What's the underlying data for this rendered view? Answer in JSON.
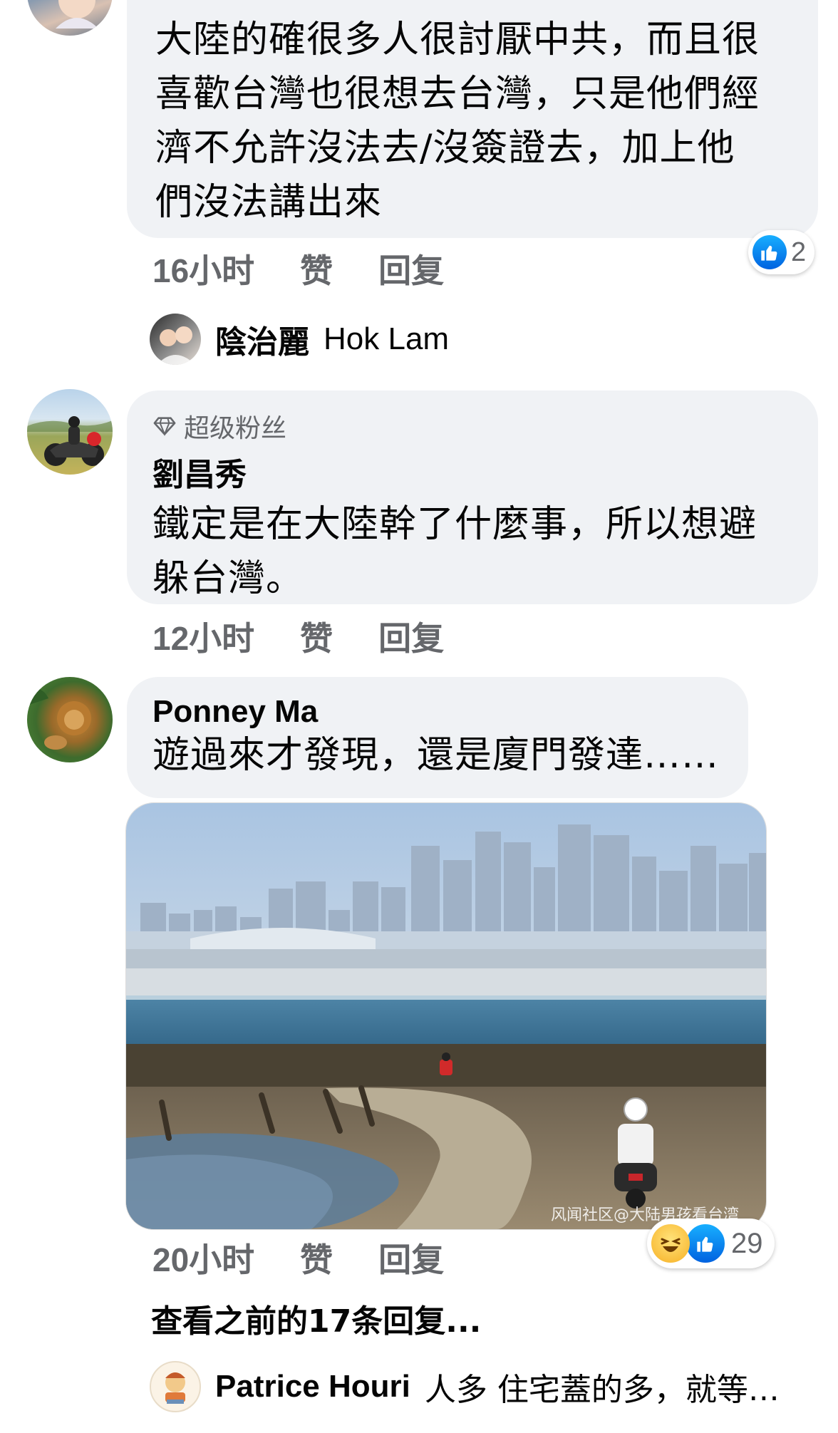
{
  "comments": [
    {
      "id": "c1",
      "text_lines": [
        "大陸的確很多人很討厭中共，而且很",
        "喜歡台灣也很想去台灣，只是他們經",
        "濟不允許沒法去/沒簽證去，加上他",
        "們沒法講出來"
      ],
      "time": "16小时",
      "like_label": "赞",
      "reply_label": "回复",
      "reaction_count": "2"
    },
    {
      "id": "c2",
      "badge": "超级粉丝",
      "author": "劉昌秀",
      "text_lines": [
        "鐵定是在大陸幹了什麼事，所以想避",
        "躲台灣。"
      ],
      "time": "12小时",
      "like_label": "赞",
      "reply_label": "回复"
    },
    {
      "id": "c3",
      "author": "Ponney Ma",
      "text_lines": [
        "遊過來才發現，還是廈門發達……"
      ],
      "image_watermark": "风闻社区@大陆男孩看台湾",
      "time": "20小时",
      "like_label": "赞",
      "reply_label": "回复",
      "reaction_count": "29"
    }
  ],
  "reply_preview_1": {
    "author": "陰治麗",
    "text": "Hok Lam"
  },
  "view_previous_replies": "查看之前的17条回复...",
  "reply_preview_2": {
    "author": "Patrice Houri",
    "text": "人多 住宅蓋的多，就等…"
  },
  "colors": {
    "bubble": "#f0f2f5",
    "meta_text": "#65676b",
    "like_blue": "#1877f2"
  }
}
